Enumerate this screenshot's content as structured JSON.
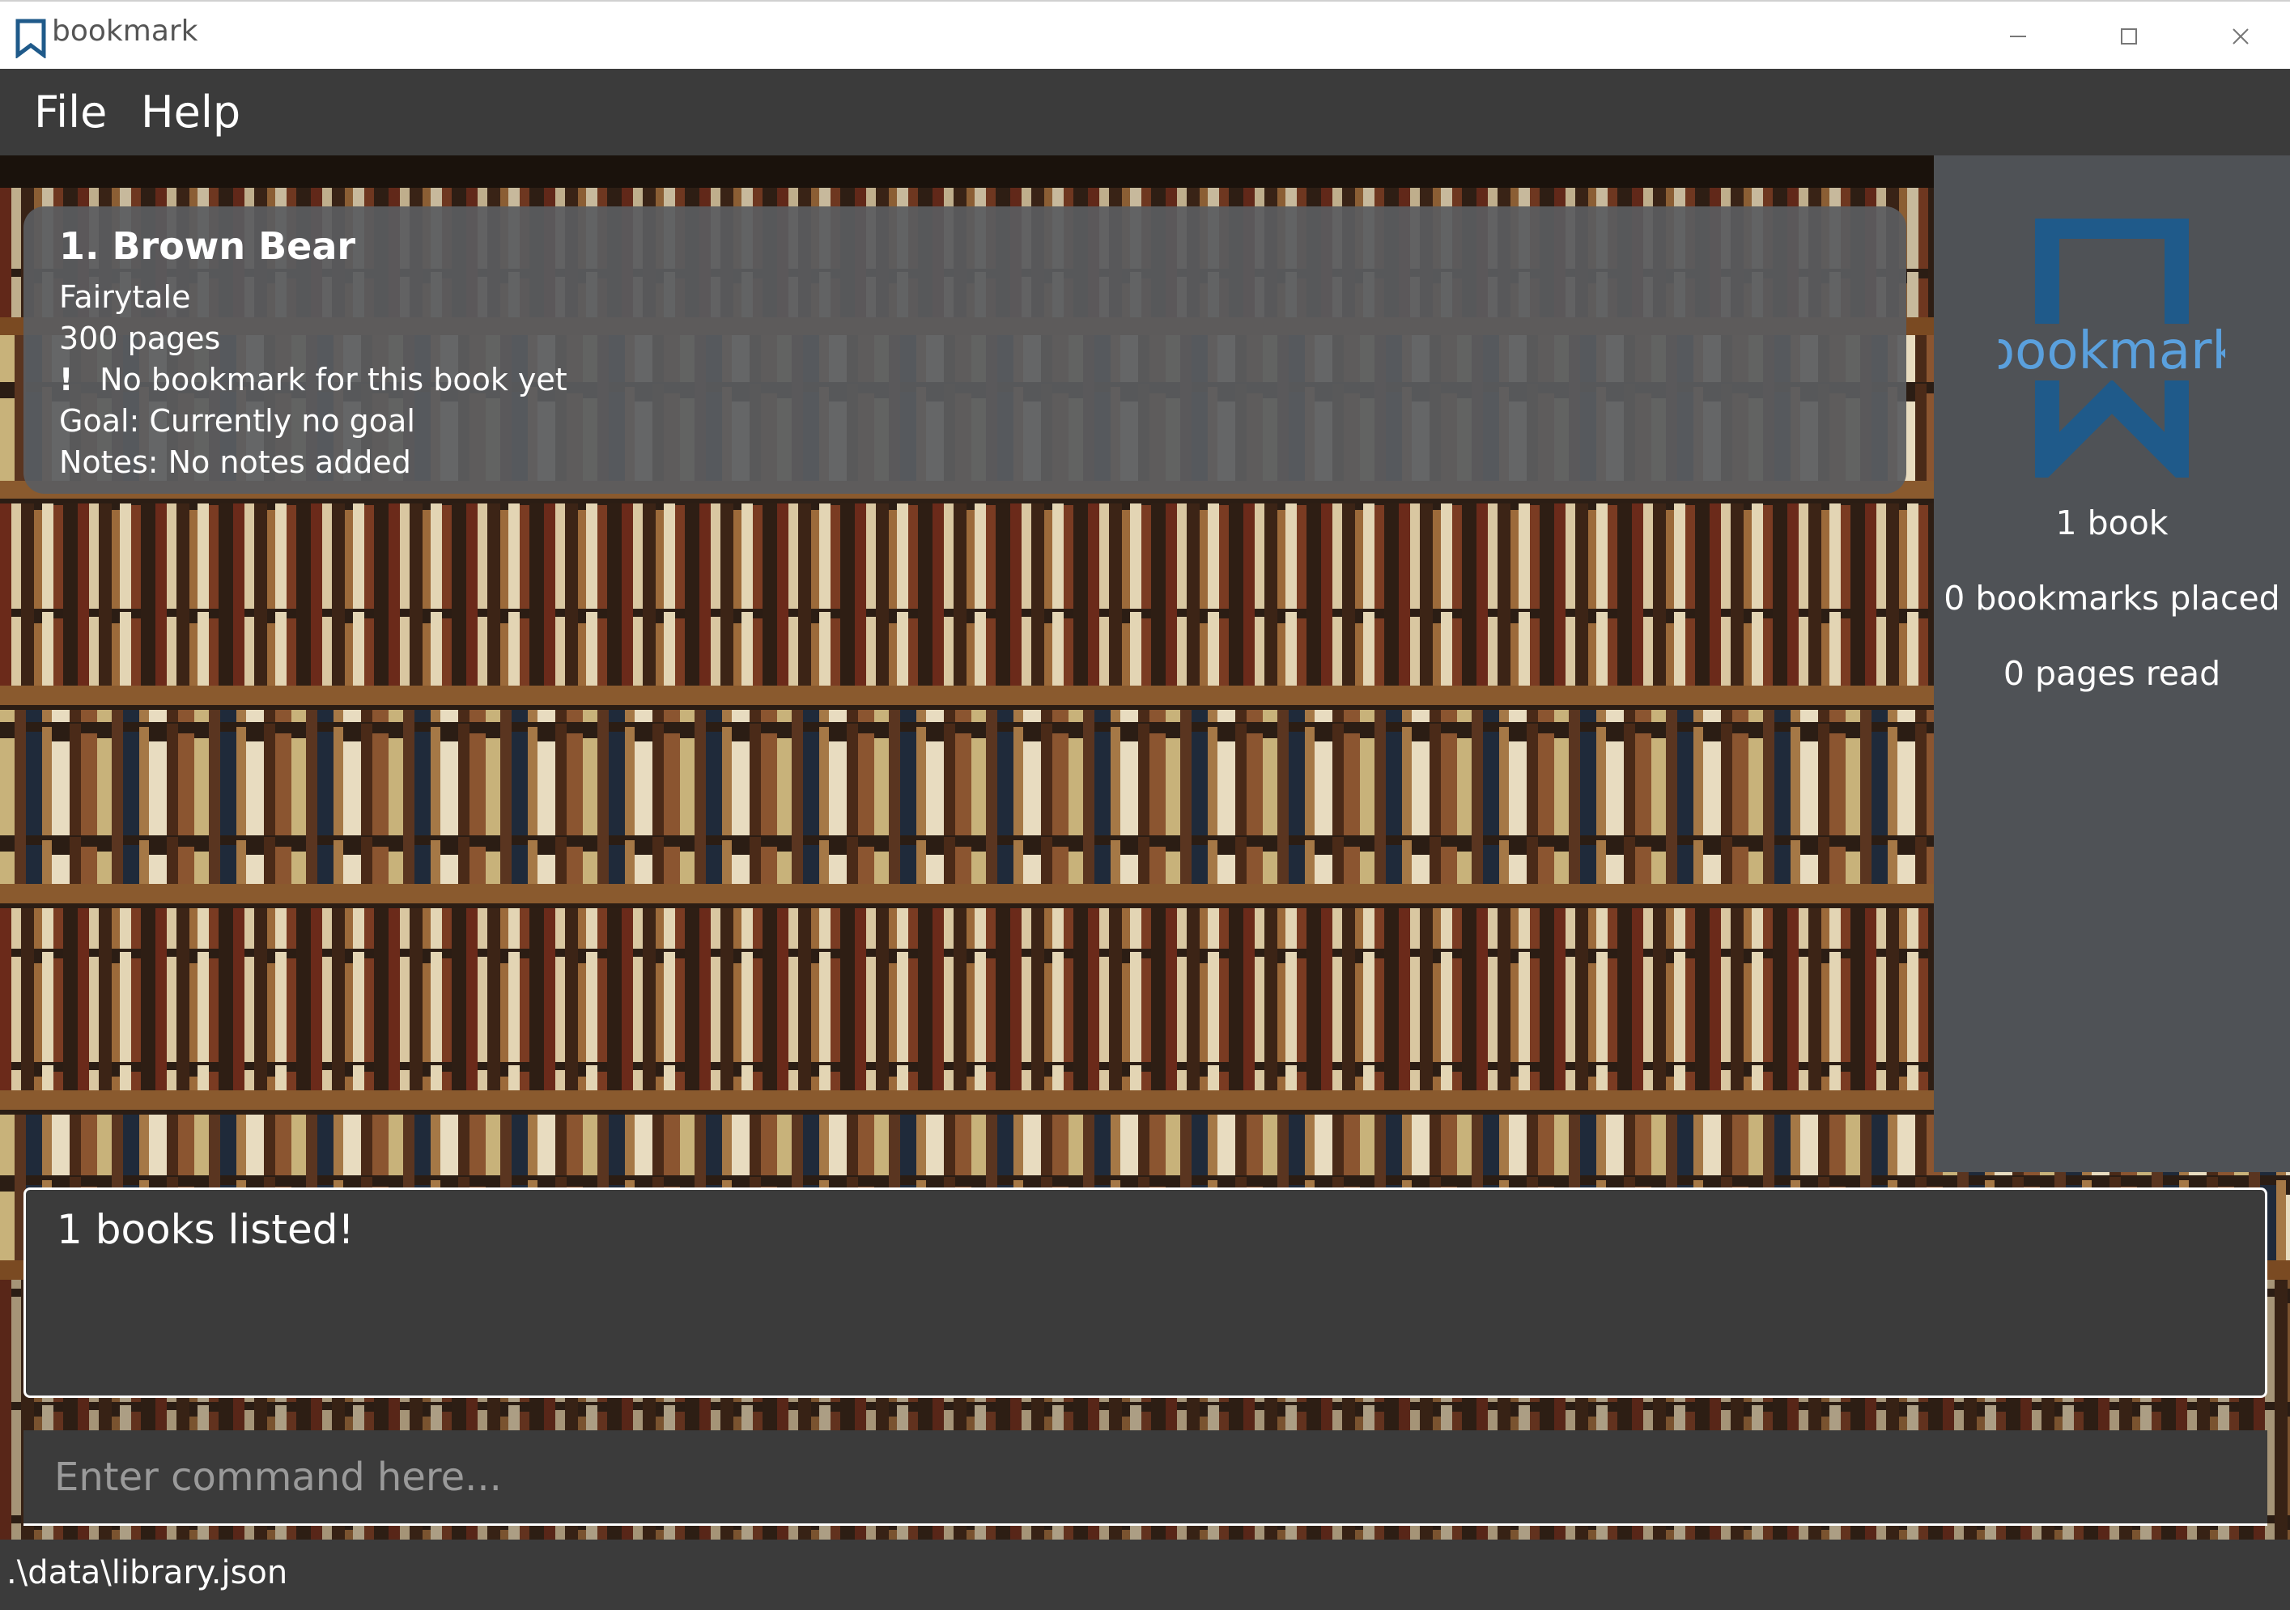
{
  "window": {
    "title": "bookmark",
    "controls": [
      "minimize-icon",
      "maximize-icon",
      "close-icon"
    ]
  },
  "menu": {
    "items": [
      "File",
      "Help"
    ]
  },
  "book_list": [
    {
      "title": "1.  Brown Bear",
      "genre": "Fairytale",
      "pages": "300 pages",
      "bookmark_icon": "exclamation-icon",
      "bookmark": "No bookmark for this book yet",
      "goal": "Goal: Currently no goal",
      "notes": "Notes: No notes added"
    }
  ],
  "side_panel": {
    "logo_text": "bookmark",
    "book_count": "1 book",
    "bookmarks_placed": "0 bookmarks placed",
    "pages_read": "0 pages read"
  },
  "result_display": {
    "text": "1 books listed!"
  },
  "command_box": {
    "placeholder": "Enter command here...",
    "value": ""
  },
  "status_bar": {
    "path": ".\\data\\library.json"
  },
  "colors": {
    "accent_blue": "#1f5a8a",
    "logo_text_blue": "#5aa0dd",
    "panel_gray": "#4f5256",
    "dark_bg": "#3b3b3b"
  }
}
